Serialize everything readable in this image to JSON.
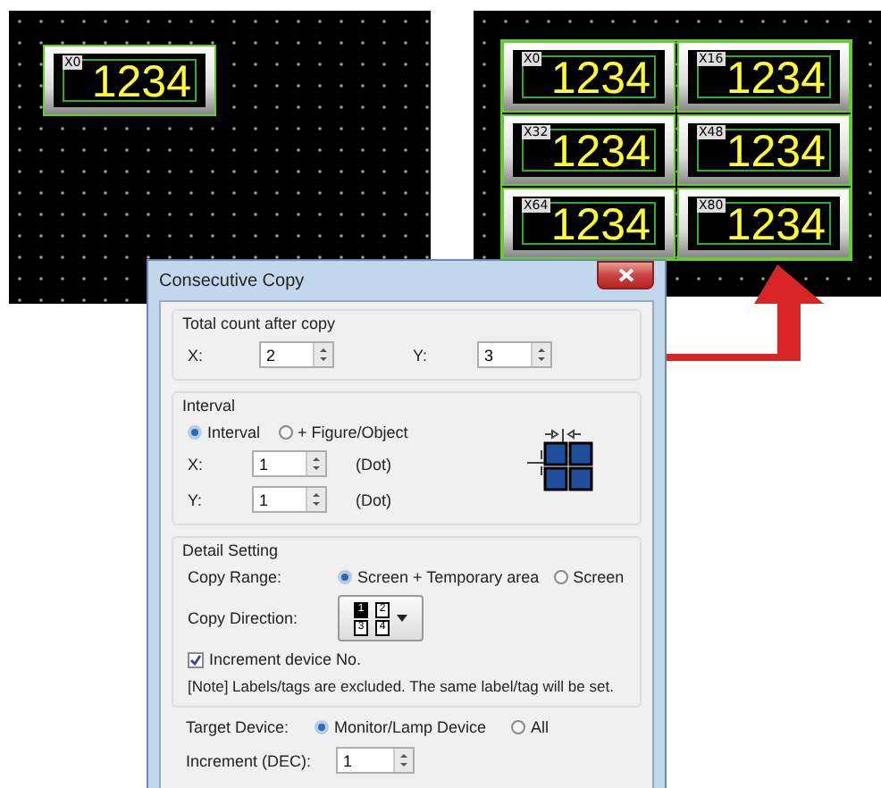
{
  "source_canvas": {
    "displays": [
      {
        "tag": "X0",
        "value": "1234"
      }
    ]
  },
  "result_canvas": {
    "displays": [
      {
        "tag": "X0",
        "value": "1234"
      },
      {
        "tag": "X16",
        "value": "1234"
      },
      {
        "tag": "X32",
        "value": "1234"
      },
      {
        "tag": "X48",
        "value": "1234"
      },
      {
        "tag": "X64",
        "value": "1234"
      },
      {
        "tag": "X80",
        "value": "1234"
      }
    ]
  },
  "dialog": {
    "title": "Consecutive Copy",
    "total_count": {
      "label": "Total count after copy",
      "x_label": "X:",
      "x_value": "2",
      "y_label": "Y:",
      "y_value": "3"
    },
    "interval": {
      "label": "Interval",
      "options": [
        {
          "label": "Interval",
          "selected": true
        },
        {
          "label": "+ Figure/Object",
          "selected": false
        }
      ],
      "rows": [
        {
          "label": "X:",
          "value": "1",
          "unit": "(Dot)"
        },
        {
          "label": "Y:",
          "value": "1",
          "unit": "(Dot)"
        }
      ]
    },
    "detail": {
      "label": "Detail Setting",
      "copy_range": {
        "label": "Copy Range:",
        "options": [
          {
            "label": "Screen + Temporary area",
            "selected": true
          },
          {
            "label": "Screen",
            "selected": false
          }
        ]
      },
      "copy_direction": {
        "label": "Copy Direction:",
        "steps": [
          "1",
          "2",
          "3",
          "4"
        ]
      },
      "increment_device": {
        "label": "Increment device No.",
        "checked": true
      },
      "note": "[Note] Labels/tags are excluded. The same label/tag will be set."
    },
    "target_device": {
      "label": "Target Device:",
      "options": [
        {
          "label": "Monitor/Lamp Device",
          "selected": true
        },
        {
          "label": "All",
          "selected": false
        }
      ]
    },
    "increment": {
      "label": "Increment (DEC):",
      "value": "1"
    }
  }
}
